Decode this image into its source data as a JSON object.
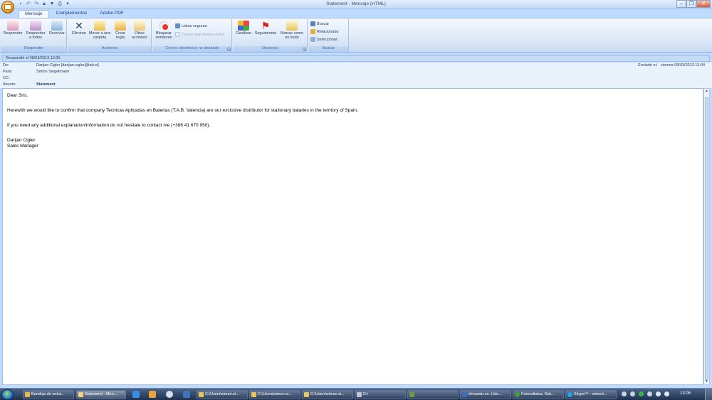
{
  "window": {
    "title": "Statement - Mensaje (HTML)"
  },
  "tabs": [
    "Mensaje",
    "Complementos",
    "Adobe PDF"
  ],
  "ribbon": {
    "responder": {
      "label": "Responder",
      "buttons": [
        "Responder",
        "Responder a todos",
        "Reenviar"
      ]
    },
    "acciones": {
      "label": "Acciones",
      "buttons": [
        "Eliminar",
        "Mover a una carpeta",
        "Crear regla",
        "Otras acciones"
      ]
    },
    "correo": {
      "label": "Correo electrónico no deseado",
      "bloquear": "Bloquear remitente",
      "listas": "Listas seguras",
      "no_deseado": "Correo que desea recibir"
    },
    "opciones": {
      "label": "Opciones",
      "buttons": [
        "Clasificar",
        "Seguimiento",
        "Marcar como no leído"
      ]
    },
    "buscar": {
      "label": "Buscar",
      "items": [
        "Buscar",
        "Relacionado",
        "Seleccionar"
      ]
    }
  },
  "header": {
    "info": "Respondió el 08/03/2013 13:05.",
    "de_label": "De:",
    "de": "Darijan Cigler [darijan.cigler@tab.si]",
    "para_label": "Para:",
    "para": "Simon Singelmann",
    "cc_label": "CC:",
    "cc": "",
    "asunto_label": "Asunto:",
    "asunto": "Statement",
    "enviado_label": "Enviado el:",
    "enviado": "viernes 08/03/2013 13:04"
  },
  "body": {
    "greeting": "Dear Sirs,",
    "para1": "Herewith we would like to confirm that company Tecnicas Aplicadas en Baterias (T.A.B. Valencia) are our exclusive distributor for stationary bataries in the territory of Spain.",
    "para2": "If you need any additional explanation/information do not hesitate to contact me (+386 41 670 950).",
    "sig_name": "Darijan Cigler",
    "sig_title": "Sales Manager"
  },
  "taskbar": {
    "items": [
      "Bandeja de entra...",
      "Statement - Men...",
      "C:\\Users\\simon.si...",
      "C:\\Users\\simon.si...",
      "C:\\Users\\simon.si...",
      "D:\\",
      "",
      "elmundo.es: Líde...",
      "Fotovoltaica. Sist...",
      "Skype™ - simont..."
    ],
    "clock": "13:06"
  },
  "colors": {
    "ribbon_bg": "#dae6f6",
    "taskbar_bg": "#1f3150",
    "accent": "#15428b"
  }
}
